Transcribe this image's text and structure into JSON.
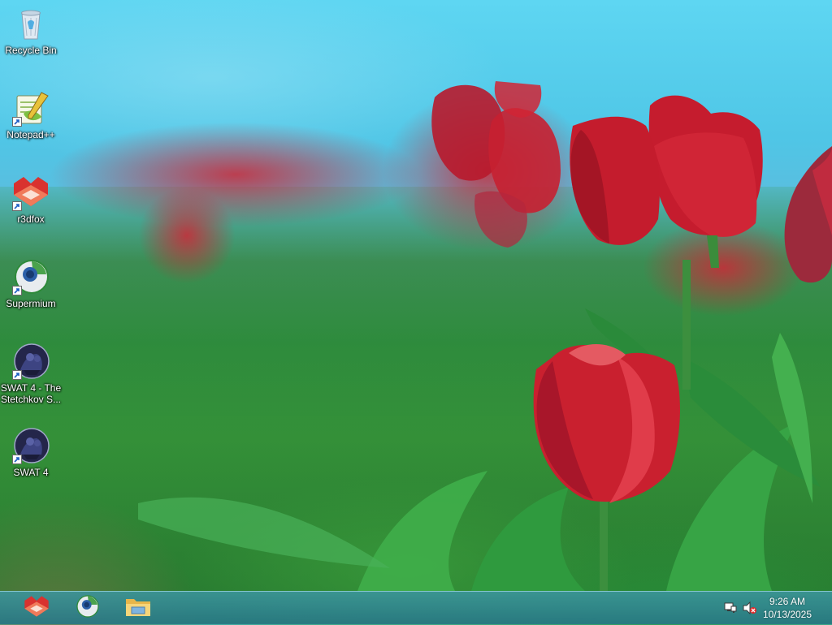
{
  "desktop": {
    "icons": [
      {
        "label": "Recycle Bin",
        "icon": "recycle-bin-icon"
      },
      {
        "label": "Notepad++",
        "icon": "notepad-plus-plus-icon"
      },
      {
        "label": "r3dfox",
        "icon": "r3dfox-icon"
      },
      {
        "label": "Supermium",
        "icon": "supermium-icon"
      },
      {
        "label": "SWAT 4 - The Stetchkov S...",
        "icon": "swat4-tss-icon"
      },
      {
        "label": "SWAT 4",
        "icon": "swat4-icon"
      }
    ]
  },
  "taskbar": {
    "pinned": [
      {
        "name": "r3dfox",
        "icon": "r3dfox-icon"
      },
      {
        "name": "Supermium",
        "icon": "supermium-icon"
      },
      {
        "name": "File Explorer",
        "icon": "folder-icon"
      }
    ],
    "tray": {
      "network_icon": "network-icon",
      "volume_icon": "volume-muted-icon"
    },
    "clock": {
      "time": "9:26 AM",
      "date": "10/13/2025"
    }
  },
  "colors": {
    "sky": "#5bd3ee",
    "tulip_red": "#c8202f",
    "leaf_green": "#2f9a3e",
    "taskbar": "#2f8c9a"
  }
}
